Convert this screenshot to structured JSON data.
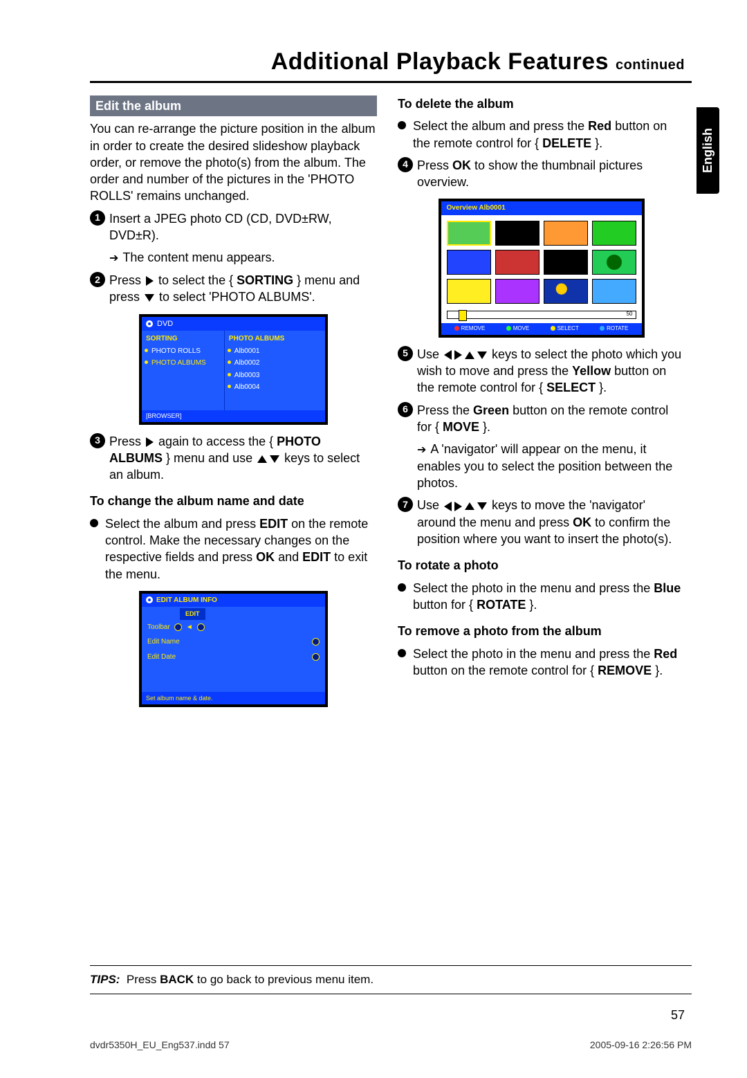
{
  "title_main": "Additional Playback Features",
  "title_sub": "continued",
  "lang_tab": "English",
  "left": {
    "section": "Edit the album",
    "intro": "You can re-arrange the picture position in the album in order to create the desired slideshow playback order, or remove the photo(s) from the album. The order and number of the pictures in the 'PHOTO ROLLS' remains unchanged.",
    "step1": "Insert a JPEG photo CD (CD, DVD±RW, DVD±R).",
    "step1_sub": "The content menu appears.",
    "step2_a": "Press ",
    "step2_b": " to select the { ",
    "step2_sort": "SORTING",
    "step2_c": " } menu and press ",
    "step2_d": " to select 'PHOTO ALBUMS'.",
    "step3_a": "Press ",
    "step3_b": " again to access the { ",
    "step3_photo": "PHOTO ALBUMS",
    "step3_c": " } menu and use ",
    "step3_d": " keys to select an album.",
    "sub1_head": "To change the album name and date",
    "sub1_a": "Select the album and press ",
    "sub1_edit1": "EDIT",
    "sub1_b": " on the remote control. Make the necessary changes on the respective fields and press ",
    "sub1_ok": "OK",
    "sub1_c": " and ",
    "sub1_edit2": "EDIT",
    "sub1_d": " to exit the menu."
  },
  "dvdmenu": {
    "disk": "DVD",
    "left_header": "SORTING",
    "left_items": [
      "PHOTO ROLLS",
      "PHOTO ALBUMS"
    ],
    "right_header": "PHOTO ALBUMS",
    "right_items": [
      "Alb0001",
      "Alb0002",
      "Alb0003",
      "Alb0004"
    ],
    "footer": "[BROWSER]"
  },
  "editmenu": {
    "title": "EDIT ALBUM INFO",
    "tab": "EDIT",
    "rows": [
      "Toolbar",
      "Edit Name",
      "Edit Date"
    ],
    "hint": "Set album name & date."
  },
  "right": {
    "del_head": "To delete the album",
    "del_a": "Select the album and press the ",
    "del_red": "Red",
    "del_b": " button on the remote control for { ",
    "del_delete": "DELETE",
    "del_c": " }.",
    "step4_a": "Press ",
    "step4_ok": "OK",
    "step4_b": " to show the thumbnail pictures overview.",
    "step5_a": "Use ",
    "step5_b": " keys to select the photo which you wish to move and press the ",
    "step5_yellow": "Yellow",
    "step5_c": " button on the remote control for { ",
    "step5_select": "SELECT",
    "step5_d": " }.",
    "step6_a": "Press the ",
    "step6_green": "Green",
    "step6_b": " button on the remote control for { ",
    "step6_move": "MOVE",
    "step6_c": " }.",
    "step6_sub": "A 'navigator' will appear on the menu, it enables you to select the position between the photos.",
    "step7_a": "Use ",
    "step7_b": " keys to move the 'navigator' around the menu and press ",
    "step7_ok": "OK",
    "step7_c": " to confirm the position where you want to insert the photo(s).",
    "rot_head": "To rotate a photo",
    "rot_a": "Select the photo in the menu and press the ",
    "rot_blue": "Blue",
    "rot_b": " button for { ",
    "rot_rotate": "ROTATE",
    "rot_c": " }.",
    "rem_head": "To remove a photo from the album",
    "rem_a": "Select the photo in the menu and press the ",
    "rem_red": "Red",
    "rem_b": " button on the remote control for { ",
    "rem_remove": "REMOVE",
    "rem_c": " }."
  },
  "thumbs": {
    "title": "Overview Alb0001",
    "count": "50",
    "buttons": [
      "REMOVE",
      "MOVE",
      "SELECT",
      "ROTATE"
    ],
    "colors": [
      "#55cc55",
      "#000",
      "#ff9933",
      "#22cc22",
      "#2244ff",
      "#cc3333",
      "#000",
      "#22cc55",
      "#ffee22",
      "#aa33ff",
      "#1133aa",
      "#44aaff"
    ]
  },
  "tips_label": "TIPS:",
  "tips_a": "Press ",
  "tips_back": "BACK",
  "tips_b": " to go back to previous menu item.",
  "page_number": "57",
  "foot_left": "dvdr5350H_EU_Eng537.indd   57",
  "foot_right": "2005-09-16   2:26:56 PM"
}
